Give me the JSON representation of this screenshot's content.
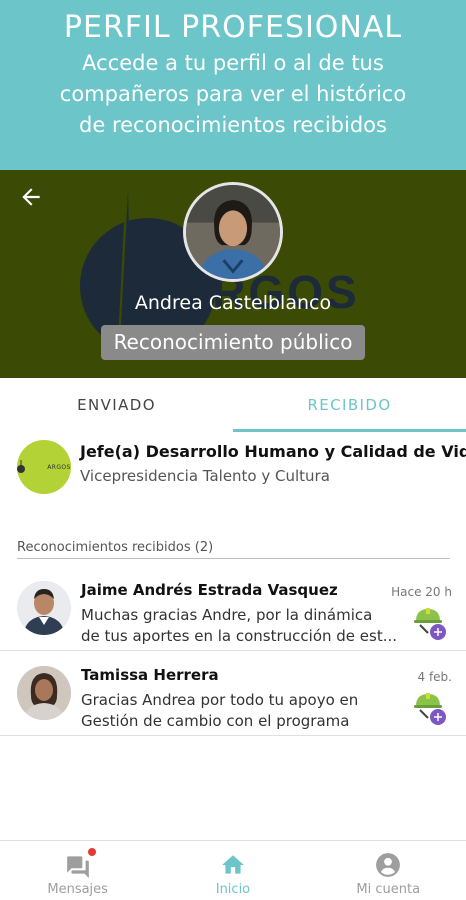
{
  "promo": {
    "title": "PERFIL PROFESIONAL",
    "subtitle_lines": [
      "Accede a tu perfil o al de tus",
      "compañeros para ver el histórico",
      "de reconocimientos recibidos"
    ]
  },
  "hero": {
    "logo_text": "ARGOS",
    "name": "Andrea Castelblanco",
    "pill": "Reconocimiento público"
  },
  "tabs": {
    "sent": "ENVIADO",
    "received": "RECIBIDO",
    "active": "received"
  },
  "org": {
    "logo_text": "ARGOS",
    "title": "Jefe(a) Desarrollo Humano y Calidad de Vida",
    "subtitle": "Vicepresidencia Talento y Cultura"
  },
  "recognitions": {
    "label": "Reconocimientos recibidos (2)",
    "items": [
      {
        "name": "Jaime Andrés Estrada Vasquez",
        "time": "Hace 20 h",
        "line1": "Muchas gracias Andre, por la dinámica",
        "line2": "de tus aportes en la construcción de est...",
        "badge": "helmet-badge-icon"
      },
      {
        "name": "Tamissa Herrera",
        "time": "4 feb.",
        "line1": "Gracias Andrea por todo tu apoyo en",
        "line2": "Gestión de cambio con el programa",
        "badge": "helmet-badge-icon"
      }
    ]
  },
  "nav": {
    "messages": "Mensajes",
    "home": "Inicio",
    "account": "Mi cuenta"
  },
  "colors": {
    "accent": "#6cc6c9",
    "hero_bg": "#3b4a04",
    "org_logo_bg": "#b2d235",
    "notification_dot": "#e53935"
  }
}
